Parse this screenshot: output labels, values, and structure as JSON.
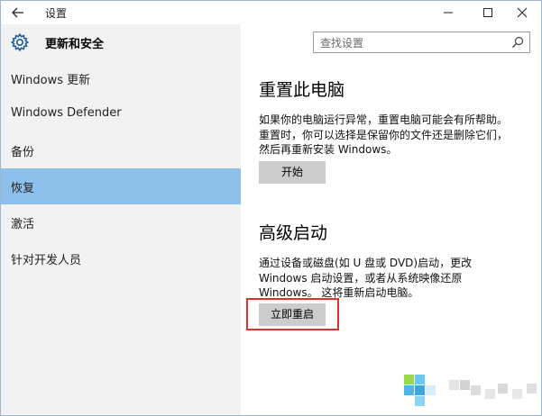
{
  "window": {
    "title": "设置"
  },
  "sidebar": {
    "header": "更新和安全",
    "items": [
      {
        "label": "Windows 更新",
        "selected": false
      },
      {
        "label": "Windows Defender",
        "selected": false
      },
      {
        "label": "备份",
        "selected": false
      },
      {
        "label": "恢复",
        "selected": true
      },
      {
        "label": "激活",
        "selected": false
      },
      {
        "label": "针对开发人员",
        "selected": false
      }
    ]
  },
  "search": {
    "placeholder": "查找设置"
  },
  "main": {
    "reset": {
      "title": "重置此电脑",
      "line1": "如果你的电脑运行异常，重置电脑可能会有所帮助。",
      "line2": "重置时，你可以选择是保留你的文件还是删除它们，",
      "line3": "然后再重新安装 Windows。",
      "button": "开始"
    },
    "advanced": {
      "title": "高级启动",
      "line1": "通过设备或磁盘(如 U 盘或 DVD)启动，更改",
      "line2": "Windows 启动设置，或者从系统映像还原",
      "line3": "Windows。 这将重新启动电脑。",
      "button": "立即重启"
    }
  },
  "colors": {
    "selected_nav": "#8ec0ec",
    "nav_bg": "#f2f2f2",
    "button_bg": "#cccccc",
    "highlight": "#e03030"
  },
  "icons": {
    "back": "back-arrow-icon",
    "settings": "gear-icon",
    "search": "search-icon",
    "minimize": "minimize-icon",
    "maximize": "maximize-icon",
    "close": "close-icon"
  }
}
